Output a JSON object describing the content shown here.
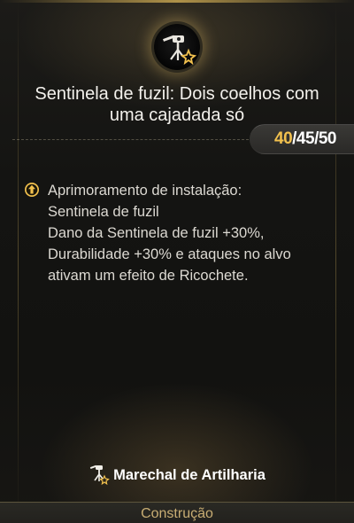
{
  "skill": {
    "icon": "rifle-sentry-turret-icon",
    "title_line1": "Sentinela de fuzil: Dois coelhos com",
    "title_line2": "uma cajadada só"
  },
  "levels": {
    "current": "40",
    "sep1": "/",
    "mid": "45",
    "sep2": "/",
    "max": "50",
    "active_color": "#f2c14e"
  },
  "description": {
    "icon": "upgrade-arrow-icon",
    "lines": [
      "Aprimoramento de instalação:",
      "Sentinela de fuzil",
      "Dano da Sentinela de fuzil +30%,",
      "Durabilidade +30% e ataques no alvo",
      "ativam um efeito de Ricochete."
    ]
  },
  "class": {
    "icon": "artillery-marshal-icon",
    "name": "Marechal de Artilharia"
  },
  "footer": {
    "label": "Construção"
  },
  "colors": {
    "accent_gold": "#f2c14e",
    "footer_text": "#c8ad73"
  }
}
